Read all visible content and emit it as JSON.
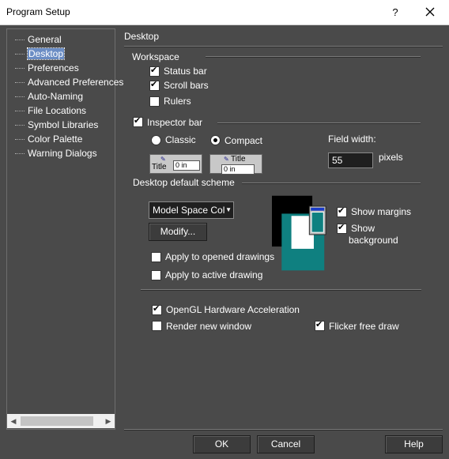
{
  "window": {
    "title": "Program Setup",
    "help_label": "?"
  },
  "tree": {
    "items": [
      {
        "label": "General",
        "selected": false
      },
      {
        "label": "Desktop",
        "selected": true
      },
      {
        "label": "Preferences",
        "selected": false
      },
      {
        "label": "Advanced Preferences",
        "selected": false
      },
      {
        "label": "Auto-Naming",
        "selected": false
      },
      {
        "label": "File Locations",
        "selected": false
      },
      {
        "label": "Symbol Libraries",
        "selected": false
      },
      {
        "label": "Color Palette",
        "selected": false
      },
      {
        "label": "Warning Dialogs",
        "selected": false
      }
    ]
  },
  "panel": {
    "title": "Desktop",
    "workspace": {
      "label": "Workspace",
      "status_bar": {
        "label": "Status bar",
        "checked": true
      },
      "scroll_bars": {
        "label": "Scroll bars",
        "checked": true
      },
      "rulers": {
        "label": "Rulers",
        "checked": false
      }
    },
    "inspector": {
      "label": "Inspector bar",
      "checked": true,
      "classic": {
        "label": "Classic",
        "selected": false
      },
      "compact": {
        "label": "Compact",
        "selected": true
      },
      "classic_preview": {
        "title": "Title",
        "value": "0 in"
      },
      "compact_preview": {
        "title": "Title",
        "value": "0 in"
      },
      "field_width_label": "Field width:",
      "field_width_value": "55",
      "pixels_label": "pixels"
    },
    "scheme": {
      "label": "Desktop default scheme",
      "selected": "Model Space Col",
      "modify_label": "Modify...",
      "apply_opened": {
        "label": "Apply to opened drawings",
        "checked": false
      },
      "apply_active": {
        "label": "Apply to active drawing",
        "checked": false
      },
      "show_margins": {
        "label": "Show margins",
        "checked": true
      },
      "show_background": {
        "label_line1": "Show",
        "label_line2": "background",
        "checked": true
      },
      "colors": {
        "background": "#000000",
        "page": "#0f8080",
        "paper": "#ffffff"
      }
    },
    "opengl": {
      "label": "OpenGL Hardware Acceleration",
      "checked": true
    },
    "render_new_window": {
      "label": "Render new window",
      "checked": false
    },
    "flicker_free": {
      "label": "Flicker free draw",
      "checked": true
    }
  },
  "footer": {
    "ok_label": "OK",
    "cancel_label": "Cancel",
    "help_label": "Help"
  }
}
